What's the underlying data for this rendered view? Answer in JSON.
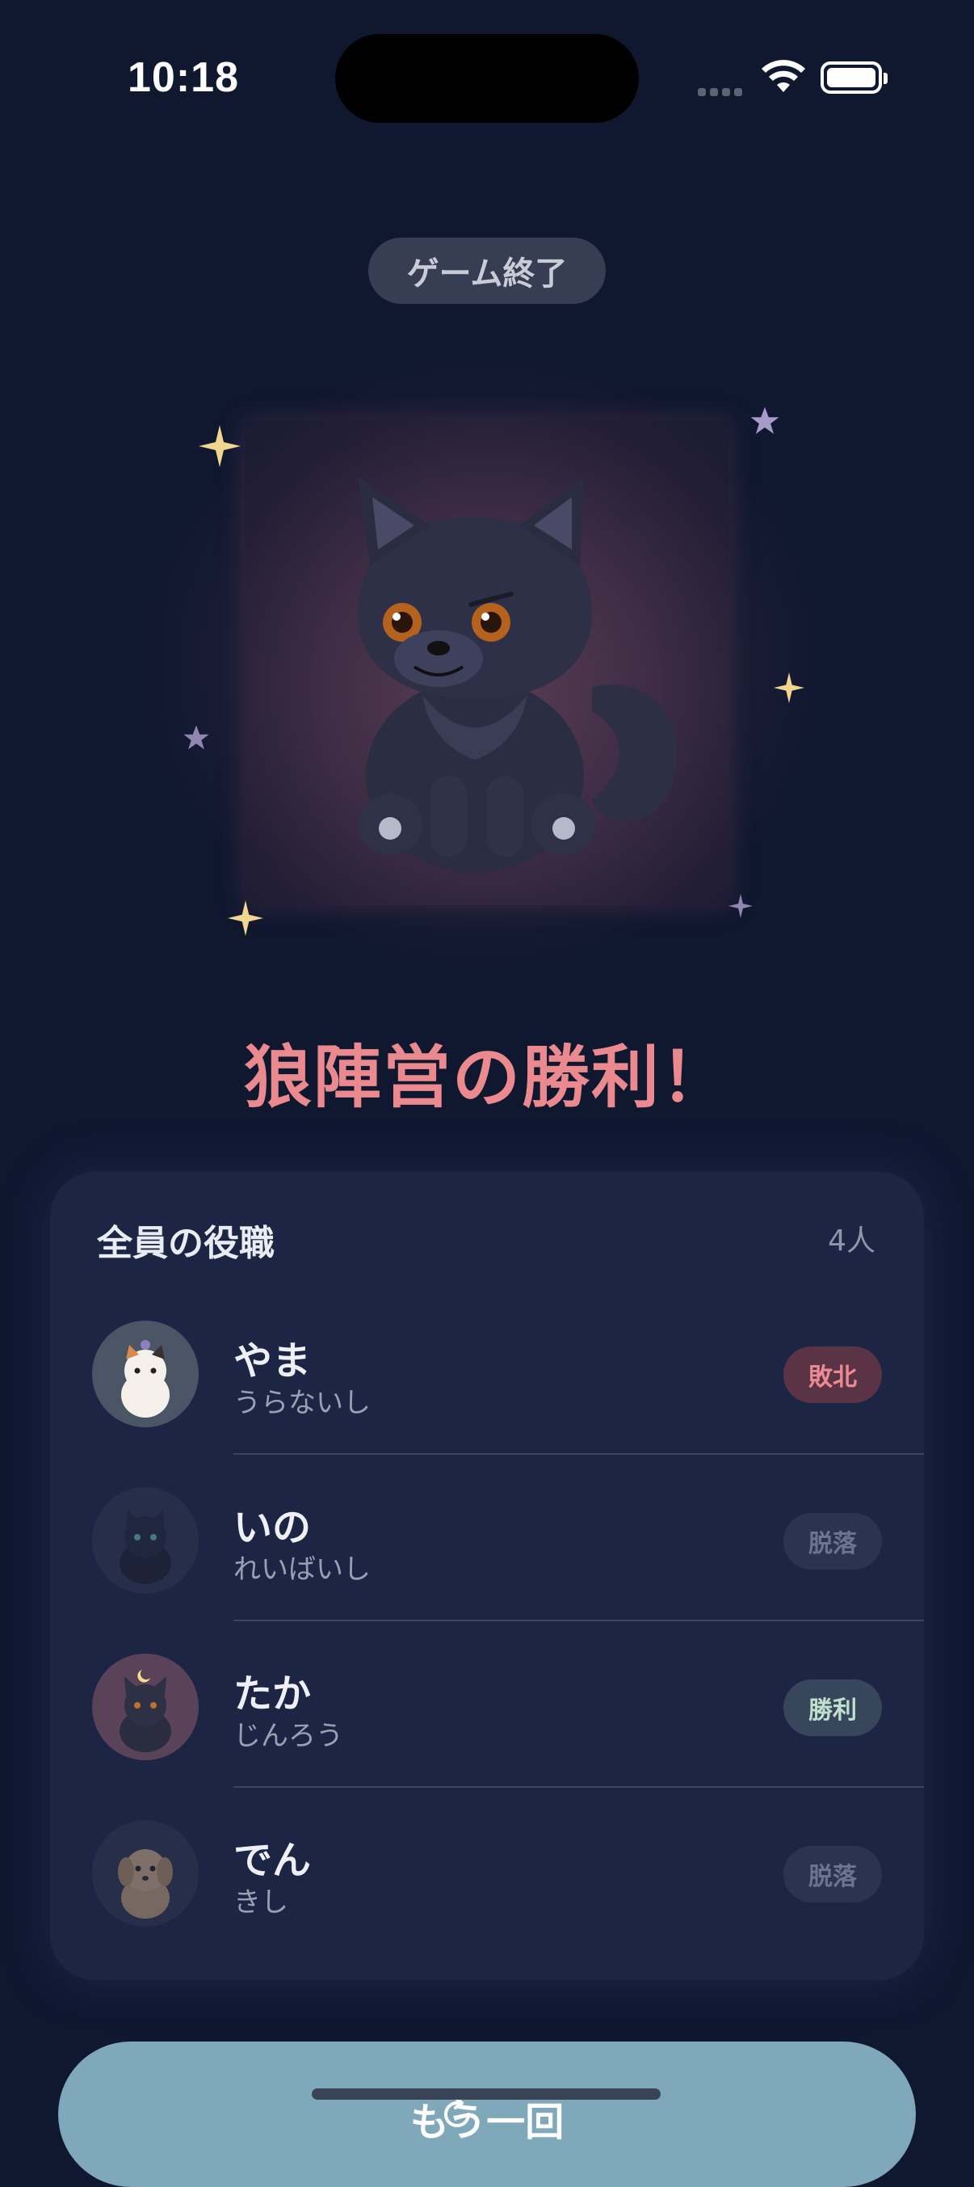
{
  "status_bar": {
    "time": "10:18"
  },
  "header": {
    "end_label": "ゲーム終了"
  },
  "result": {
    "title": "狼陣営の勝利！",
    "title_color": "#eb8a8e"
  },
  "roles_card": {
    "title": "全員の役職",
    "count": "4人",
    "players": [
      {
        "name": "やま",
        "role": "うらないし",
        "result": "敗北",
        "avatar": "calico-cat"
      },
      {
        "name": "いの",
        "role": "れいばいし",
        "result": "脱落",
        "avatar": "black-cat"
      },
      {
        "name": "たか",
        "role": "じんろう",
        "result": "勝利",
        "avatar": "wolf"
      },
      {
        "name": "でん",
        "role": "きし",
        "result": "脱落",
        "avatar": "dog"
      }
    ]
  },
  "footer": {
    "again_label": "もう一回",
    "again_icon": "retry-icon"
  },
  "colors": {
    "background": "#101830",
    "card": "#1c2544",
    "button": "#7fa8ba"
  }
}
